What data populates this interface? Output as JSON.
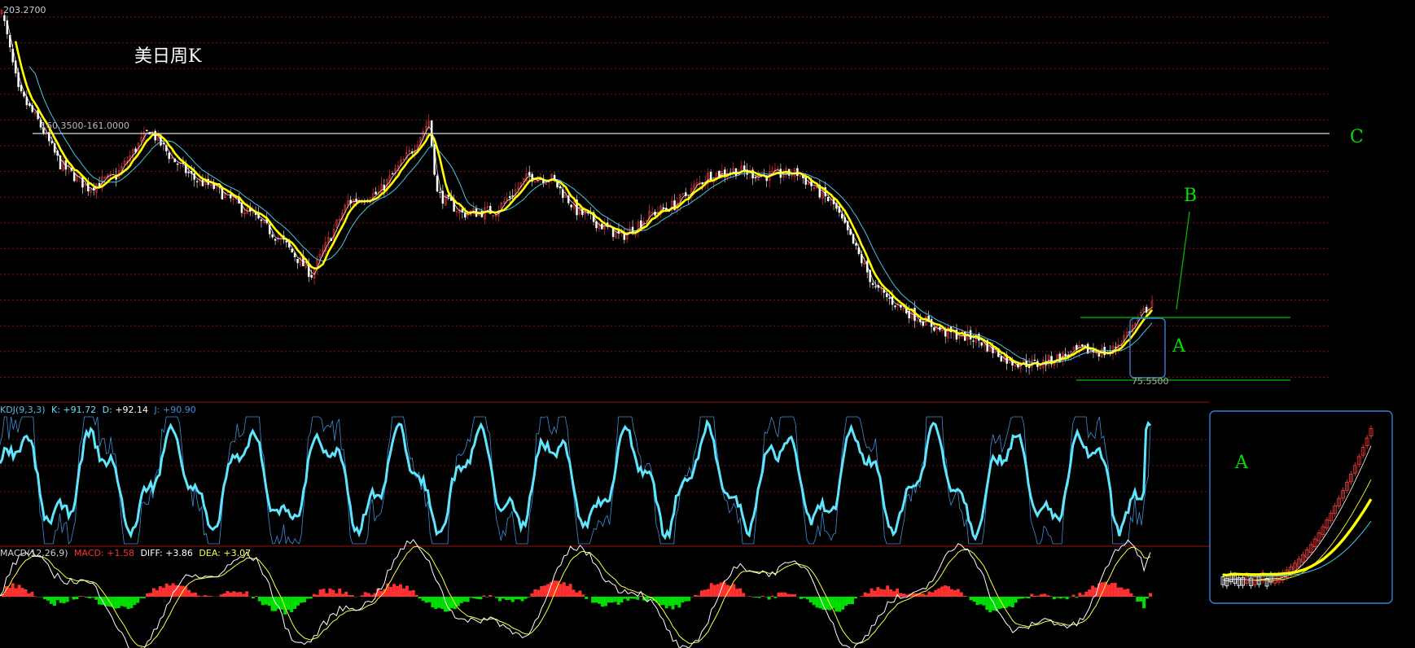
{
  "title": "美日周K",
  "price_axis": {
    "high_label": "203.2700",
    "low_label": "75.5500",
    "ylim": [
      75.55,
      203.27
    ]
  },
  "resistance_line": {
    "label": "160.3500-161.0000",
    "value": 160.35
  },
  "annotations": {
    "label_c": "C",
    "label_b": "B",
    "label_a": "A",
    "inset_label": "A"
  },
  "kdj_header": {
    "name": "KDJ(9,3,3)",
    "k_label": "K:",
    "k_value": "+91.72",
    "d_label": "D:",
    "d_value": "+92.14",
    "j_label": "J:",
    "j_value": "+90.90"
  },
  "macd_header": {
    "name": "MACD(12,26,9)",
    "macd_label": "MACD:",
    "macd_value": "+1.58",
    "diff_label": "DIFF:",
    "diff_value": "+3.86",
    "dea_label": "DEA:",
    "dea_value": "+3.07"
  },
  "colors": {
    "background": "#000000",
    "candle_up": "#ff3b3b",
    "candle_down": "#ffffff",
    "ma_fast": "#ffffff",
    "ma_mid": "#ffff00",
    "ma_slow": "#40c8e0",
    "kdj_k": "#5fe6ff",
    "kdj_j": "#3a8fd8",
    "macd_pos": "#ff3030",
    "macd_neg": "#00e000",
    "diff": "#ffffff",
    "dea": "#ffff40",
    "annotation": "#00e000",
    "box": "#3a7fd0",
    "grid": "#8a1010"
  },
  "chart_data": {
    "type": "line",
    "description_keypoints_x_axis": "weekly bar index",
    "x": [
      0,
      6,
      13,
      21,
      31,
      41,
      53,
      61,
      69,
      76,
      89,
      101,
      111,
      124,
      135,
      147,
      153,
      156,
      165,
      177,
      189,
      197,
      206,
      213,
      222,
      233,
      241,
      253,
      263,
      273,
      285,
      298,
      313,
      323,
      338,
      349,
      361,
      371,
      387,
      397,
      406,
      412
    ],
    "y": [
      203.27,
      175,
      165,
      150,
      142,
      146,
      162,
      152,
      145,
      142,
      133,
      123,
      112,
      137,
      140,
      155,
      165,
      140,
      133,
      134,
      146,
      145,
      134,
      130,
      125,
      133,
      136,
      146,
      148,
      146,
      147,
      136,
      107,
      100,
      92,
      90,
      82,
      81,
      86,
      85,
      95,
      103
    ],
    "ylim": [
      75.55,
      203.27
    ],
    "low_value": 75.55,
    "resistance": 160.35
  }
}
